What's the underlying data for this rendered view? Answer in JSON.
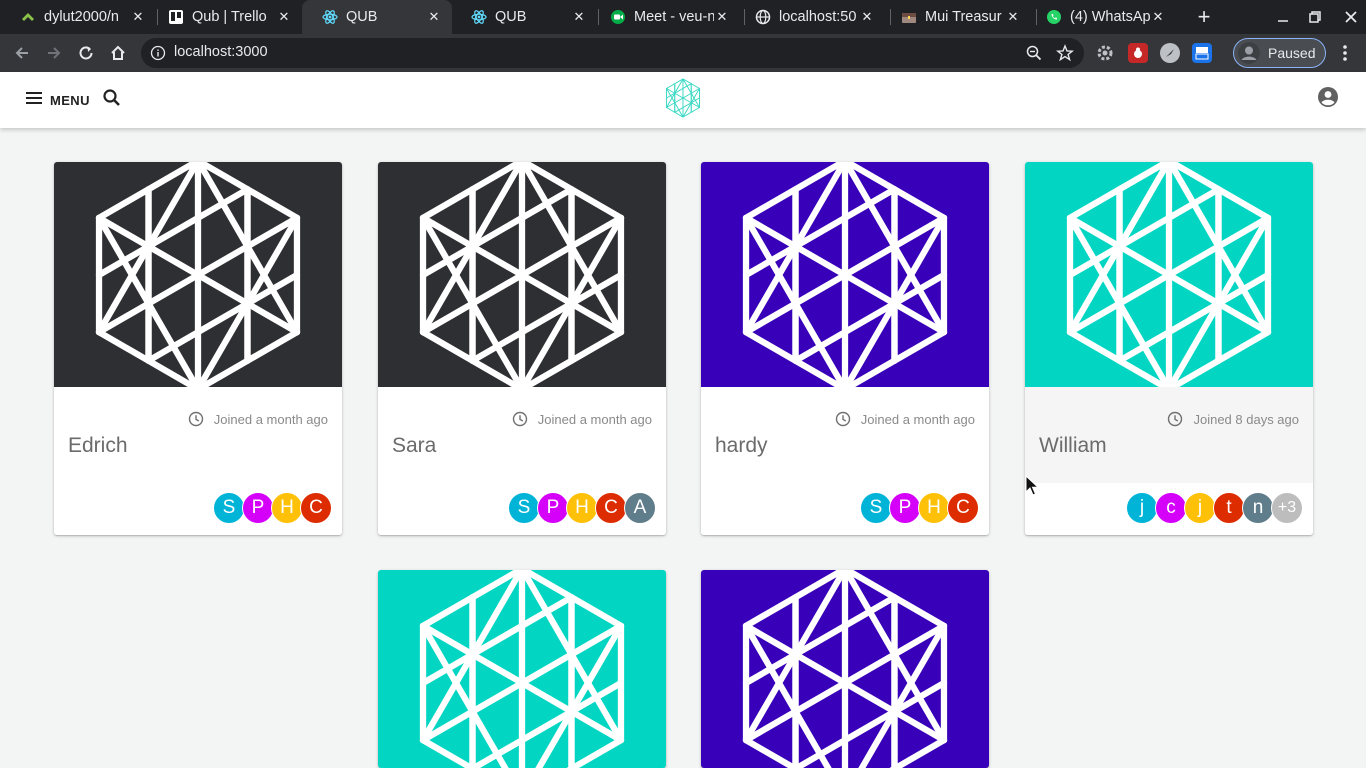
{
  "browser": {
    "tabs": [
      {
        "title": "dylut2000/n",
        "icon": "github-icon",
        "active": false
      },
      {
        "title": "Qub | Trello",
        "icon": "trello-icon",
        "active": false
      },
      {
        "title": "QUB",
        "icon": "react-icon",
        "active": true
      },
      {
        "title": "QUB",
        "icon": "react-icon",
        "active": false
      },
      {
        "title": "Meet - veu-n",
        "icon": "meet-icon",
        "active": false
      },
      {
        "title": "localhost:50",
        "icon": "globe-icon",
        "active": false
      },
      {
        "title": "Mui Treasur",
        "icon": "treasure-icon",
        "active": false
      },
      {
        "title": "(4) WhatsAp",
        "icon": "whatsapp-icon",
        "active": false
      }
    ],
    "url": "localhost:3000",
    "profile_label": "Paused"
  },
  "appbar": {
    "menu_label": "MENU"
  },
  "colors": {
    "dark": "#2e2f33",
    "purple": "#3800b8",
    "teal": "#02d6c3",
    "logo": "#3ad9c4"
  },
  "cards": [
    {
      "name": "Edrich",
      "joined": "Joined a month ago",
      "banner": "#2e2f33",
      "avatars": [
        {
          "letter": "S",
          "color": "#00b4d8"
        },
        {
          "letter": "P",
          "color": "#d500f9"
        },
        {
          "letter": "H",
          "color": "#ffc107"
        },
        {
          "letter": "C",
          "color": "#dd2c00"
        }
      ]
    },
    {
      "name": "Sara",
      "joined": "Joined a month ago",
      "banner": "#2e2f33",
      "avatars": [
        {
          "letter": "S",
          "color": "#00b4d8"
        },
        {
          "letter": "P",
          "color": "#d500f9"
        },
        {
          "letter": "H",
          "color": "#ffc107"
        },
        {
          "letter": "C",
          "color": "#dd2c00"
        },
        {
          "letter": "A",
          "color": "#607d8b"
        }
      ]
    },
    {
      "name": "hardy",
      "joined": "Joined a month ago",
      "banner": "#3800b8",
      "avatars": [
        {
          "letter": "S",
          "color": "#00b4d8"
        },
        {
          "letter": "P",
          "color": "#d500f9"
        },
        {
          "letter": "H",
          "color": "#ffc107"
        },
        {
          "letter": "C",
          "color": "#dd2c00"
        }
      ]
    },
    {
      "name": "William",
      "joined": "Joined 8 days ago",
      "banner": "#02d6c3",
      "avatars": [
        {
          "letter": "j",
          "color": "#00b4d8"
        },
        {
          "letter": "c",
          "color": "#d500f9"
        },
        {
          "letter": "j",
          "color": "#ffc107"
        },
        {
          "letter": "t",
          "color": "#dd2c00"
        },
        {
          "letter": "n",
          "color": "#607d8b"
        },
        {
          "letter": "+3",
          "color": "#bdbdbd"
        }
      ]
    },
    {
      "name": "",
      "joined": "",
      "banner": "#02d6c3",
      "avatars": []
    },
    {
      "name": "",
      "joined": "",
      "banner": "#3800b8",
      "avatars": []
    }
  ]
}
